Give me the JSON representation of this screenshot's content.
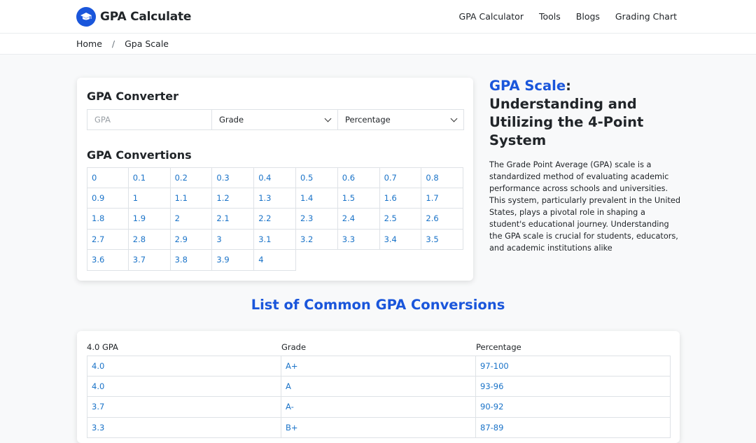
{
  "header": {
    "logo_text": "GPA Calculate",
    "nav": [
      "GPA Calculator",
      "Tools",
      "Blogs",
      "Grading Chart"
    ]
  },
  "breadcrumb": {
    "home": "Home",
    "separator": "/",
    "current": "Gpa Scale"
  },
  "converter": {
    "title": "GPA Converter",
    "gpa_placeholder": "GPA",
    "grade_select": "Grade",
    "percentage_select": "Percentage",
    "conversions_title": "GPA Convertions",
    "values": [
      "0",
      "0.1",
      "0.2",
      "0.3",
      "0.4",
      "0.5",
      "0.6",
      "0.7",
      "0.8",
      "0.9",
      "1",
      "1.1",
      "1.2",
      "1.3",
      "1.4",
      "1.5",
      "1.6",
      "1.7",
      "1.8",
      "1.9",
      "2",
      "2.1",
      "2.2",
      "2.3",
      "2.4",
      "2.5",
      "2.6",
      "2.7",
      "2.8",
      "2.9",
      "3",
      "3.1",
      "3.2",
      "3.3",
      "3.4",
      "3.5",
      "3.6",
      "3.7",
      "3.8",
      "3.9",
      "4"
    ]
  },
  "article": {
    "title_highlight": "GPA Scale",
    "title_rest": ": Understanding and Utilizing the 4-Point System",
    "body": "The Grade Point Average (GPA) scale is a standardized method of evaluating academic performance across schools and universities. This system, particularly prevalent in the United States, plays a pivotal role in shaping a student's educational journey. Understanding the GPA scale is crucial for students, educators, and academic institutions alike"
  },
  "common": {
    "title": "List of Common GPA Conversions",
    "headers": [
      "4.0 GPA",
      "Grade",
      "Percentage"
    ],
    "rows": [
      [
        "4.0",
        "A+",
        "97-100"
      ],
      [
        "4.0",
        "A",
        "93-96"
      ],
      [
        "3.7",
        "A-",
        "90-92"
      ],
      [
        "3.3",
        "B+",
        "87-89"
      ]
    ]
  },
  "colors": {
    "accent": "#1a56db",
    "link": "#1a73c8"
  }
}
